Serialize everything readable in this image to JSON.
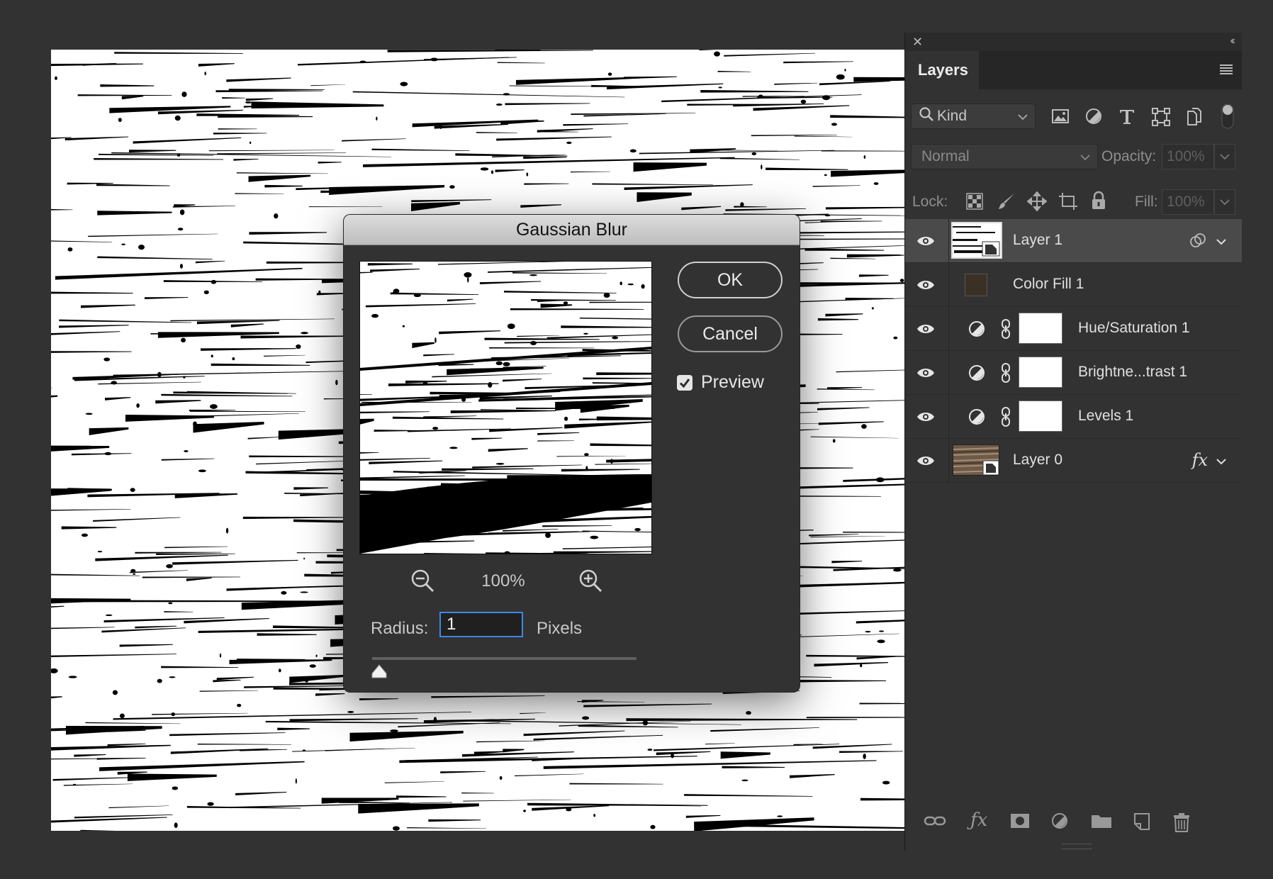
{
  "dialog": {
    "title": "Gaussian Blur",
    "ok_label": "OK",
    "cancel_label": "Cancel",
    "preview_label": "Preview",
    "preview_checked": true,
    "zoom_level": "100%",
    "radius_label": "Radius:",
    "radius_value": "1",
    "units_label": "Pixels",
    "radius_slider_fraction": 0.0
  },
  "panel": {
    "tab": "Layers",
    "filter_kind": "Kind",
    "blend_mode": "Normal",
    "opacity_label": "Opacity:",
    "opacity_value": "100%",
    "lock_label": "Lock:",
    "fill_label": "Fill:",
    "fill_value": "100%",
    "layers": [
      {
        "name": "Layer 1",
        "selected": true,
        "type": "smart-object"
      },
      {
        "name": "Color Fill 1",
        "type": "fill",
        "swatch": "#3a3124"
      },
      {
        "name": "Hue/Saturation 1",
        "type": "adjustment"
      },
      {
        "name": "Brightne...trast 1",
        "type": "adjustment"
      },
      {
        "name": "Levels 1",
        "type": "adjustment"
      },
      {
        "name": "Layer 0",
        "type": "smart-object",
        "fx": "fx"
      }
    ]
  },
  "colors": {
    "app_bg": "#323232",
    "focus_blue": "#3f87e6",
    "selected_row": "#4a4a4a"
  }
}
